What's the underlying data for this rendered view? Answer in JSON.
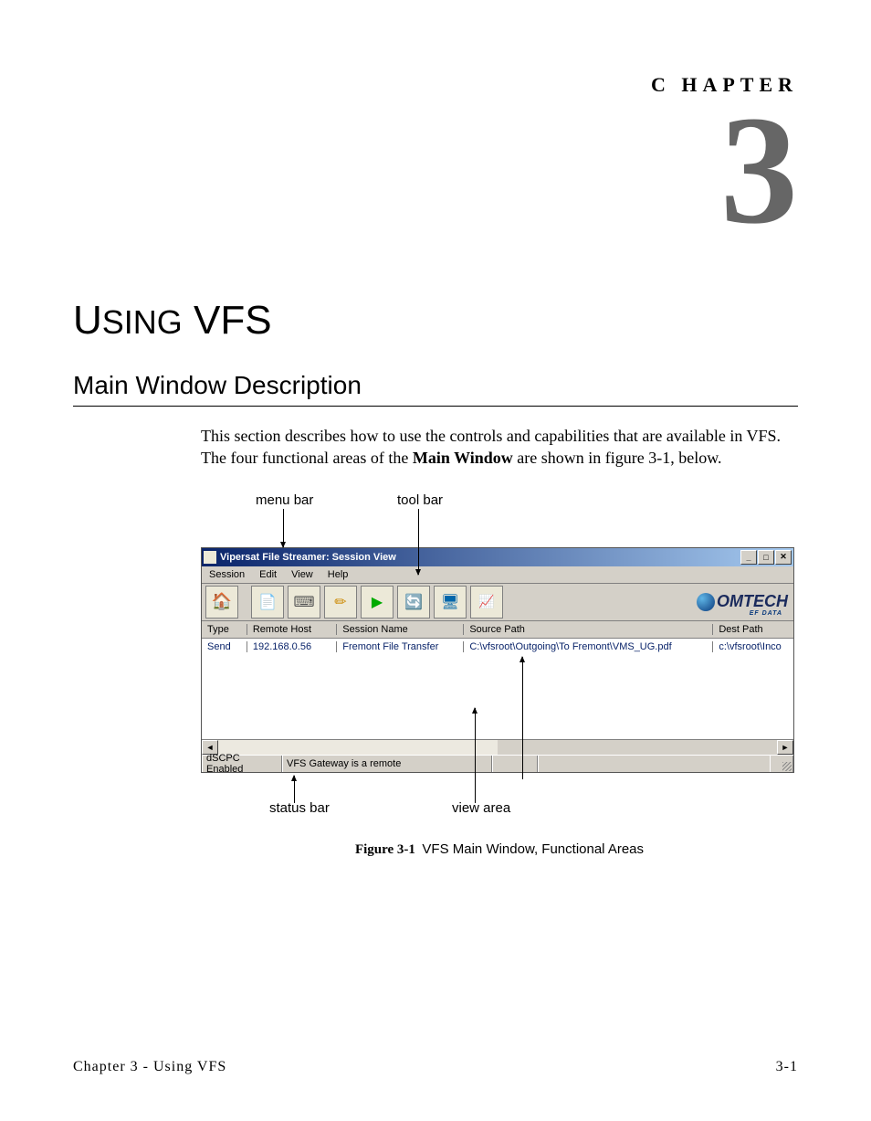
{
  "chapter": {
    "label": "C HAPTER",
    "number": "3"
  },
  "title": "USING VFS",
  "section_heading": "Main Window Description",
  "body_paragraph": {
    "part1": "This section describes how to use the controls and capabilities that are available in VFS. The four functional areas of the ",
    "bold": "Main Window",
    "part2": " are shown in figure 3-1, below."
  },
  "callouts": {
    "menu_bar": "menu bar",
    "tool_bar": "tool bar",
    "status_bar": "status bar",
    "view_area": "view area"
  },
  "window": {
    "title": "Vipersat File Streamer: Session View",
    "menus": [
      "Session",
      "Edit",
      "View",
      "Help"
    ],
    "brand": "OMTECH",
    "brand_sub": "EF DATA",
    "columns": {
      "type": "Type",
      "host": "Remote Host",
      "session": "Session Name",
      "source": "Source Path",
      "dest": "Dest Path"
    },
    "row": {
      "type": "Send",
      "host": "192.168.0.56",
      "session": "Fremont File Transfer",
      "source": "C:\\vfsroot\\Outgoing\\To Fremont\\VMS_UG.pdf",
      "dest": "c:\\vfsroot\\Inco"
    },
    "status": {
      "p1": "dSCPC Enabled",
      "p2": "VFS Gateway is a remote"
    }
  },
  "figure": {
    "label": "Figure 3-1",
    "caption": "VFS Main Window, Functional Areas"
  },
  "footer": {
    "left": "Chapter 3 - Using VFS",
    "right": "3-1"
  }
}
